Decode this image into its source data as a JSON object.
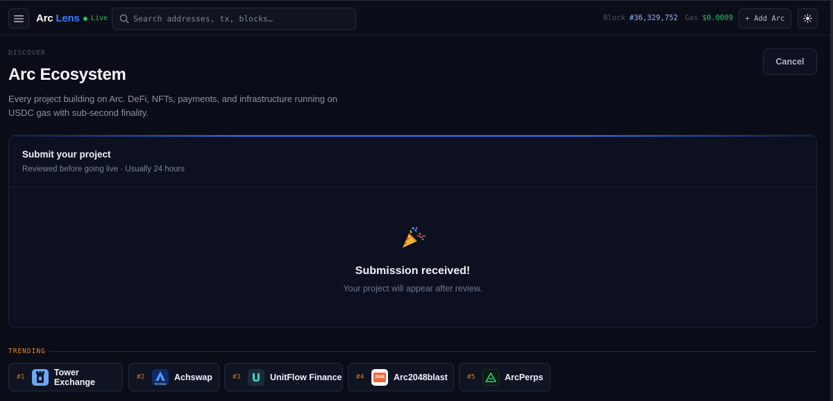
{
  "topbar": {
    "brand_word1": "Arc",
    "brand_word2": "Lens",
    "live_label": "Live",
    "search_placeholder": "Search addresses, tx, blocks…",
    "block_label": "Block",
    "block_value": "#36,329,752",
    "gas_label": "Gas",
    "gas_value": "$0.0009",
    "add_button": "+ Add Arc",
    "icons": {
      "menu": "menu-icon",
      "search": "search-icon",
      "theme": "sun-icon"
    }
  },
  "header": {
    "eyebrow": "DISCOVER",
    "title": "Arc Ecosystem",
    "description": "Every project building on Arc. DeFi, NFTs, payments, and infrastructure running on USDC gas with sub-second finality.",
    "cancel_button": "Cancel"
  },
  "submit_card": {
    "title": "Submit your project",
    "subtitle": "Reviewed before going live · Usually 24 hours",
    "success_icon": "party-popper-icon",
    "success_title": "Submission received!",
    "success_message": "Your project will appear after review."
  },
  "trending": {
    "label": "TRENDING",
    "items": [
      {
        "rank": "#1",
        "name": "Tower Exchange",
        "logo": "tower-exchange-logo"
      },
      {
        "rank": "#2",
        "name": "Achswap",
        "logo": "achswap-logo",
        "logo_text": "Achswap"
      },
      {
        "rank": "#3",
        "name": "UnitFlow Finance",
        "logo": "unitflow-logo"
      },
      {
        "rank": "#4",
        "name": "Arc2048blast",
        "logo": "arc2048blast-logo",
        "logo_text": "2048"
      },
      {
        "rank": "#5",
        "name": "ArcPerps",
        "logo": "arcperps-logo"
      }
    ]
  },
  "colors": {
    "accent": "#3b7bff",
    "live_green": "#22c55e",
    "trending_orange": "#e08a2e",
    "background": "#0a0d17"
  }
}
